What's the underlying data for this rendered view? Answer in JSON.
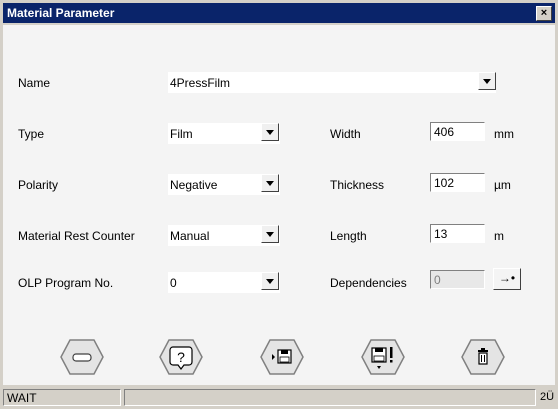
{
  "window": {
    "title": "Material Parameter",
    "close_label": "×"
  },
  "fields": {
    "name": {
      "label": "Name",
      "value": "4PressFilm"
    },
    "type": {
      "label": "Type",
      "value": "Film"
    },
    "polarity": {
      "label": "Polarity",
      "value": "Negative"
    },
    "rest_counter": {
      "label": "Material Rest Counter",
      "value": "Manual"
    },
    "olp": {
      "label": "OLP Program No.",
      "value": "0"
    },
    "width": {
      "label": "Width",
      "value": "406",
      "unit": "mm"
    },
    "thickness": {
      "label": "Thickness",
      "value": "102",
      "unit": "µm"
    },
    "length": {
      "label": "Length",
      "value": "13",
      "unit": "m"
    },
    "dependencies": {
      "label": "Dependencies",
      "value": "0",
      "button_icon": "→•"
    }
  },
  "toolbar": {
    "buttons": [
      {
        "name": "minus-button",
        "icon": "minus-icon"
      },
      {
        "name": "help-button",
        "icon": "help-icon"
      },
      {
        "name": "save-button",
        "icon": "save-icon"
      },
      {
        "name": "save-warning-button",
        "icon": "save-warning-icon"
      },
      {
        "name": "delete-button",
        "icon": "trash-icon"
      }
    ]
  },
  "status": {
    "text": "WAIT",
    "message": "",
    "corner": "2Ü"
  }
}
